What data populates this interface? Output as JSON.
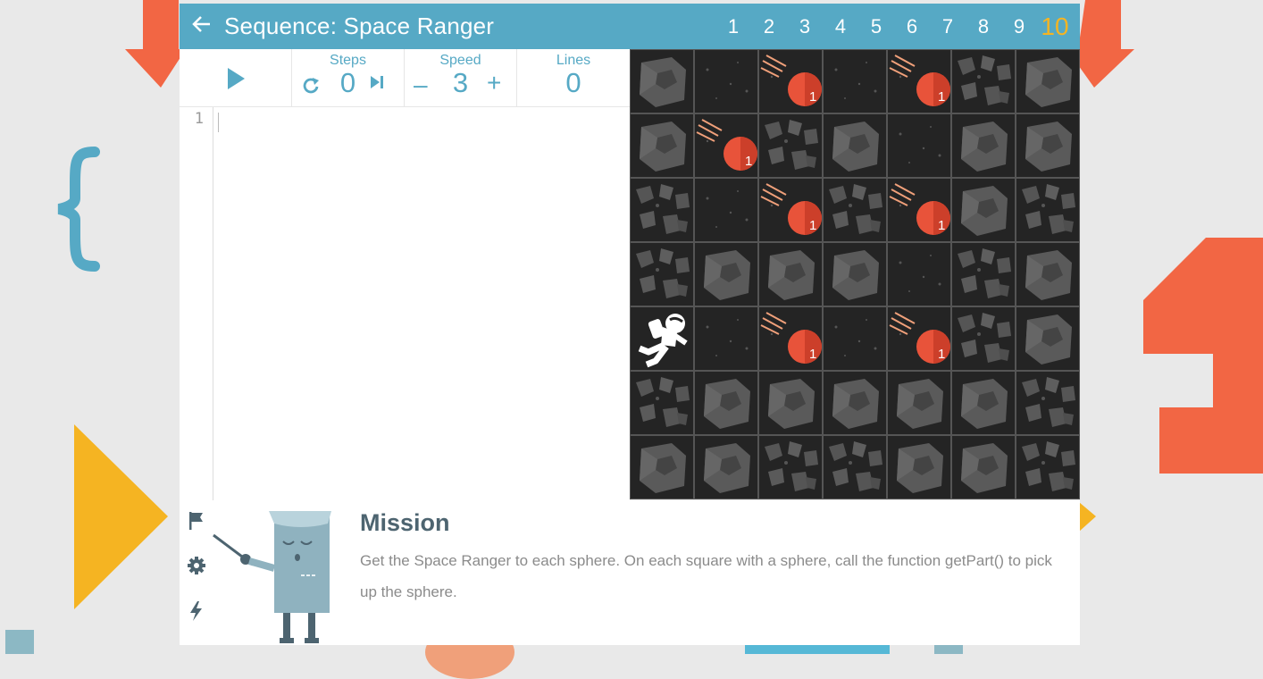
{
  "header": {
    "back_icon": "back-arrow-icon",
    "title": "Sequence: Space Ranger"
  },
  "levels": [
    "1",
    "2",
    "3",
    "4",
    "5",
    "6",
    "7",
    "8",
    "9",
    "10"
  ],
  "current_level": "10",
  "controls": {
    "steps_label": "Steps",
    "steps_value": "0",
    "speed_label": "Speed",
    "speed_value": "3",
    "speed_minus": "–",
    "speed_plus": "+",
    "lines_label": "Lines",
    "lines_value": "0"
  },
  "editor": {
    "line_numbers": [
      "1"
    ]
  },
  "grid": {
    "legend": {
      "A": "big-asteroid",
      "R": "rock-cluster",
      "E": "empty-space",
      "S": "sphere",
      "P": "player"
    },
    "rows": [
      [
        "A",
        "E",
        "S",
        "E",
        "S",
        "R",
        "A"
      ],
      [
        "A",
        "S",
        "R",
        "A",
        "E",
        "A",
        "A"
      ],
      [
        "R",
        "E",
        "S",
        "R",
        "S",
        "A",
        "R"
      ],
      [
        "R",
        "A",
        "A",
        "A",
        "E",
        "R",
        "A"
      ],
      [
        "P",
        "E",
        "S",
        "E",
        "S",
        "R",
        "A"
      ],
      [
        "R",
        "A",
        "A",
        "A",
        "A",
        "A",
        "R"
      ],
      [
        "A",
        "A",
        "R",
        "R",
        "A",
        "A",
        "R"
      ]
    ],
    "sphere_count": "1"
  },
  "mission": {
    "title": "Mission",
    "text": "Get the Space Ranger to each sphere. On each square with a sphere, call the function getPart() to pick up the sphere.",
    "icons": [
      "flag-icon",
      "gear-icon",
      "lightning-icon"
    ]
  },
  "colors": {
    "accent": "#56a9c5",
    "active_level": "#f5b422",
    "sphere": "#e8533a",
    "decor_orange": "#f26644",
    "decor_yellow": "#f5b422"
  }
}
